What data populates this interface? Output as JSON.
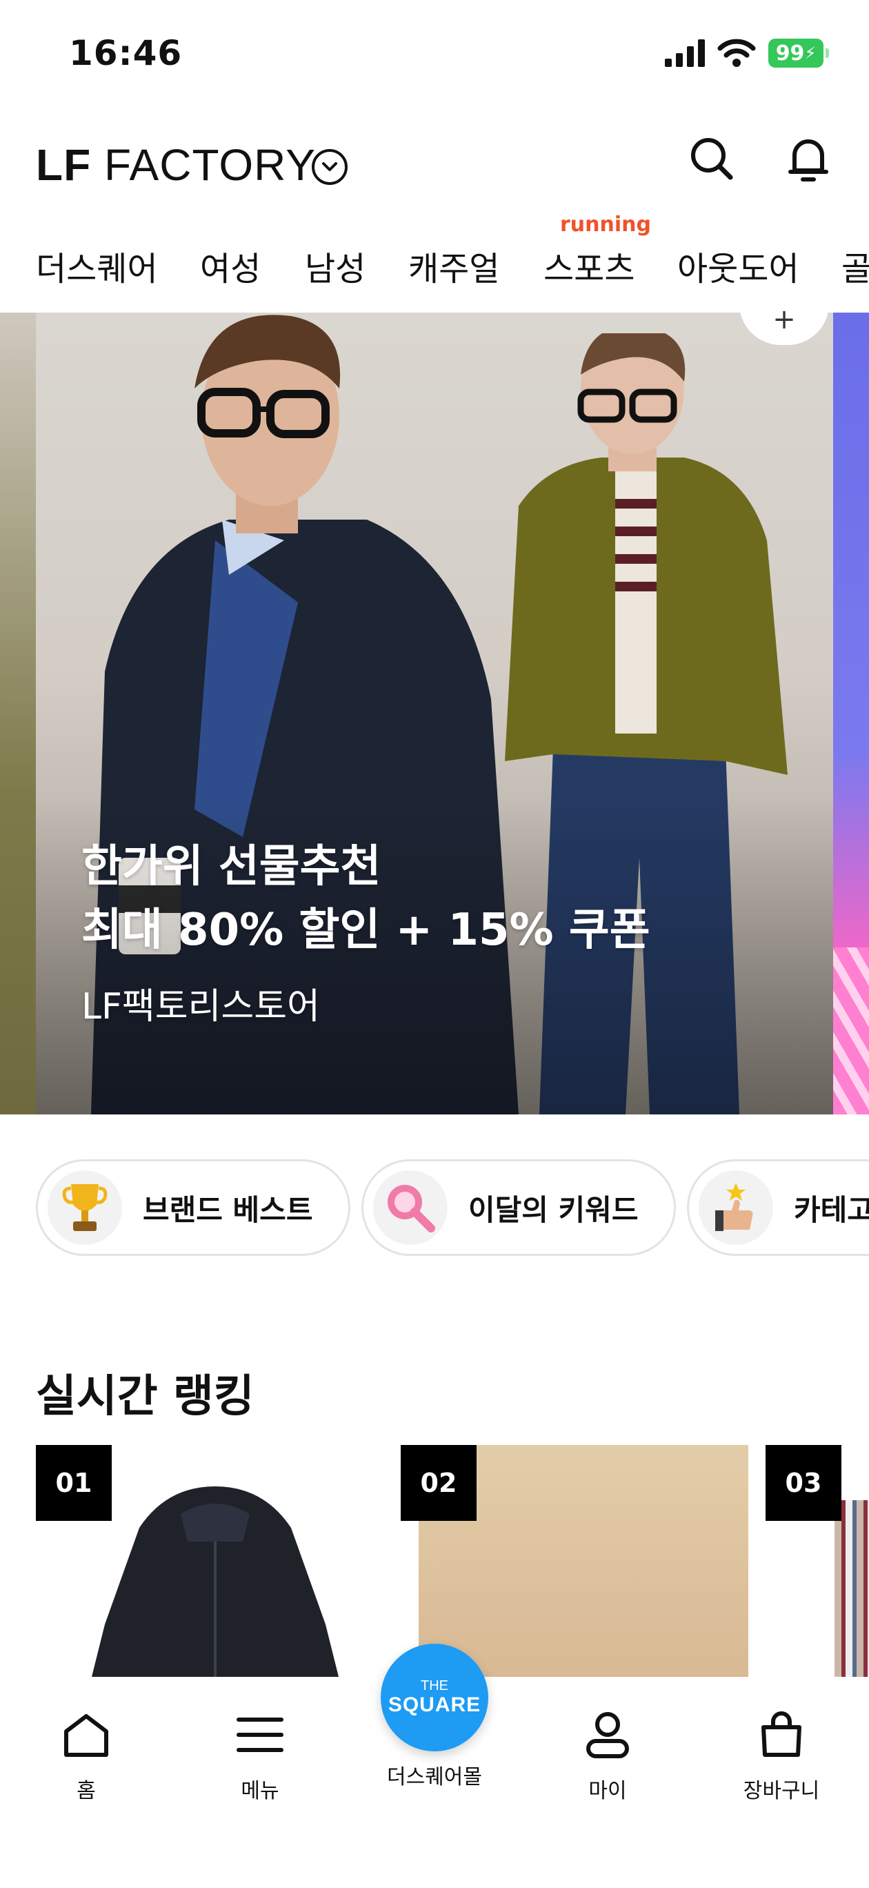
{
  "status_bar": {
    "time": "16:46",
    "battery": "99"
  },
  "header": {
    "logo_bold": "LF",
    "logo_rest": " FACTORY"
  },
  "tabs": [
    {
      "label": "더스퀘어"
    },
    {
      "label": "여성"
    },
    {
      "label": "남성"
    },
    {
      "label": "캐주얼"
    },
    {
      "label": "스포츠",
      "badge": "running"
    },
    {
      "label": "아웃도어"
    },
    {
      "label": "골"
    }
  ],
  "banner": {
    "title_line1": "한가위 선물추천",
    "title_line2": "최대 80% 할인 + 15% 쿠폰",
    "subtitle": "LF팩토리스토어",
    "plus": "+"
  },
  "chips": [
    {
      "label": "브랜드 베스트",
      "icon": "trophy-icon"
    },
    {
      "label": "이달의 키워드",
      "icon": "magnifier-icon"
    },
    {
      "label": "카테고",
      "icon": "thumbs-up-icon"
    }
  ],
  "ranking": {
    "title": "실시간 랭킹",
    "items": [
      {
        "rank": "01"
      },
      {
        "rank": "02"
      },
      {
        "rank": "03"
      }
    ]
  },
  "bottom_nav": {
    "items": [
      {
        "label": "홈",
        "icon": "home-icon"
      },
      {
        "label": "메뉴",
        "icon": "menu-icon"
      },
      {
        "label": "더스퀘어몰",
        "icon": "the-square-icon"
      },
      {
        "label": "마이",
        "icon": "user-icon"
      },
      {
        "label": "장바구니",
        "icon": "cart-icon"
      }
    ],
    "fab_small": "THE",
    "fab_big": "SQUARE"
  },
  "colors": {
    "accent_blue": "#1e9bf3",
    "badge_orange": "#f0522a",
    "battery_green": "#34c759"
  }
}
